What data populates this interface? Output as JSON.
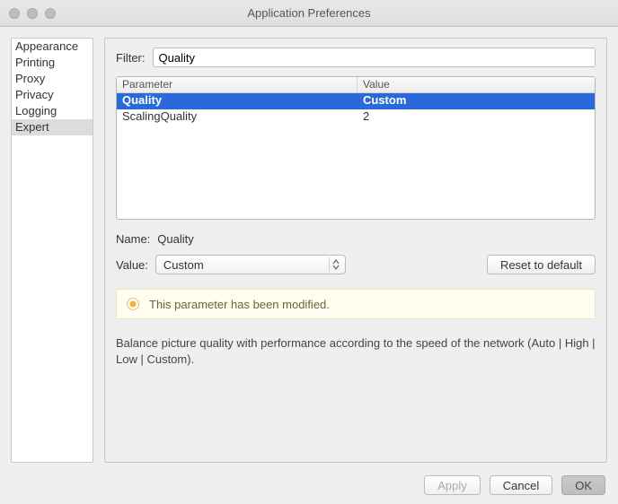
{
  "window": {
    "title": "Application Preferences"
  },
  "sidebar": {
    "items": [
      {
        "label": "Appearance"
      },
      {
        "label": "Printing"
      },
      {
        "label": "Proxy"
      },
      {
        "label": "Privacy"
      },
      {
        "label": "Logging"
      },
      {
        "label": "Expert"
      }
    ],
    "selected_index": 5
  },
  "filter": {
    "label": "Filter:",
    "value": "Quality"
  },
  "table": {
    "columns": {
      "parameter": "Parameter",
      "value": "Value"
    },
    "rows": [
      {
        "parameter": "Quality",
        "value": "Custom"
      },
      {
        "parameter": "ScalingQuality",
        "value": "2"
      }
    ],
    "selected_index": 0
  },
  "name": {
    "label": "Name:",
    "value": "Quality"
  },
  "value": {
    "label": "Value:",
    "selected": "Custom"
  },
  "reset": {
    "label": "Reset to default"
  },
  "notice": {
    "text": "This parameter has been modified."
  },
  "description": "Balance picture quality with performance according to the speed of the network (Auto | High | Low | Custom).",
  "footer": {
    "apply": "Apply",
    "cancel": "Cancel",
    "ok": "OK"
  }
}
